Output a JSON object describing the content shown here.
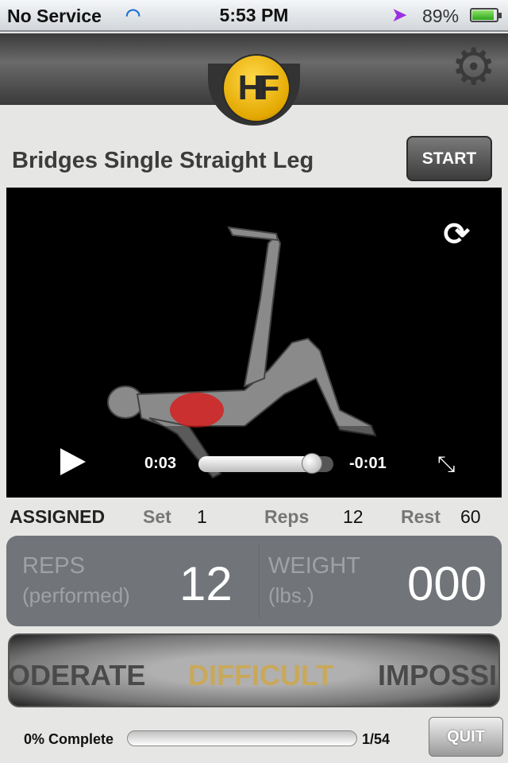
{
  "status_bar": {
    "carrier": "No Service",
    "time": "5:53 PM",
    "battery": "89%",
    "battery_level": 0.89
  },
  "header": {
    "logo_text": "HF"
  },
  "exercise": {
    "title": "Bridges Single Straight Leg",
    "start_label": "START"
  },
  "video": {
    "elapsed": "0:03",
    "remaining": "-0:01",
    "progress": 0.84
  },
  "assigned": {
    "label": "ASSIGNED",
    "set_label": "Set",
    "set_value": "1",
    "reps_label": "Reps",
    "reps_value": "12",
    "rest_label": "Rest",
    "rest_value": "60"
  },
  "input_panel": {
    "reps_label": "REPS",
    "reps_sub": "(performed)",
    "reps_value": "12",
    "weight_label": "WEIGHT",
    "weight_sub": "(lbs.)",
    "weight_value": "000"
  },
  "difficulty": {
    "options": [
      "ODERATE",
      "DIFFICULT",
      "IMPOSSI"
    ],
    "selected": "DIFFICULT",
    "accent": "#c9a85a"
  },
  "footer": {
    "progress_label": "0% Complete",
    "progress": 0,
    "count": "1/54",
    "quit_label": "QUIT"
  }
}
